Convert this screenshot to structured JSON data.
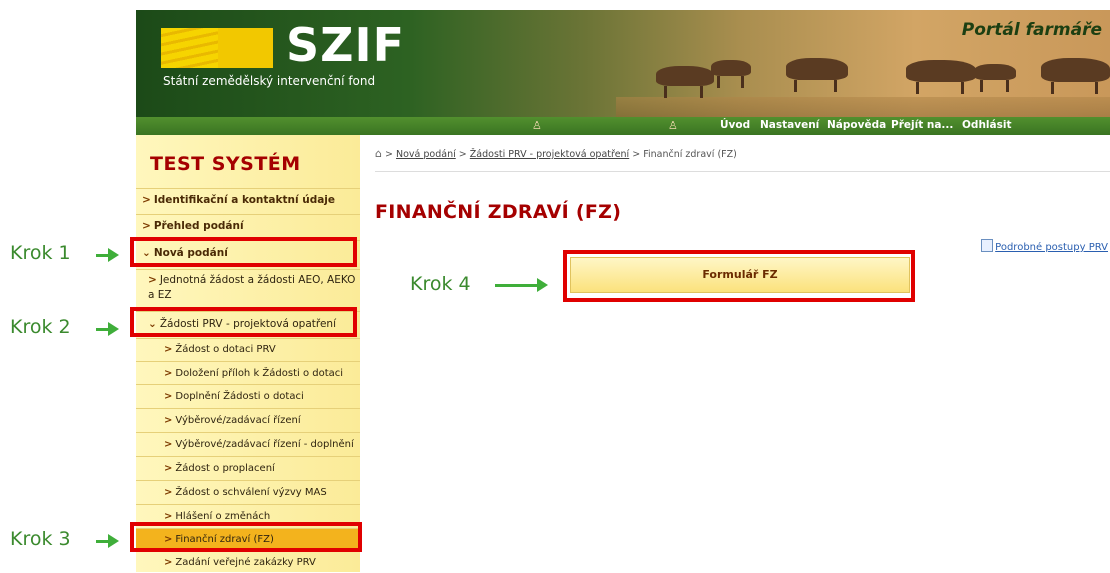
{
  "header": {
    "brand": "SZIF",
    "brand_subtitle": "Státní zemědělský intervenční fond",
    "portal_title": "Portál farmáře"
  },
  "topnav": {
    "items": [
      {
        "label": "Úvod"
      },
      {
        "label": "Nastavení"
      },
      {
        "label": "Nápověda"
      },
      {
        "label": "Přejít na..."
      },
      {
        "label": "Odhlásit"
      }
    ]
  },
  "sidebar": {
    "title": "TEST SYSTÉM",
    "items": [
      {
        "label": "Identifikační a kontaktní údaje"
      },
      {
        "label": "Přehled podání"
      },
      {
        "label": "Nová podání"
      },
      {
        "label": "Jednotná žádost a žádosti AEO, AEKO a EZ"
      },
      {
        "label": "Žádosti PRV - projektová opatření"
      },
      {
        "label": "Žádost o dotaci PRV"
      },
      {
        "label": "Doložení příloh k Žádosti o dotaci"
      },
      {
        "label": "Doplnění Žádosti o dotaci"
      },
      {
        "label": "Výběrové/zadávací řízení"
      },
      {
        "label": "Výběrové/zadávací řízení - doplnění"
      },
      {
        "label": "Žádost o proplacení"
      },
      {
        "label": "Žádost o schválení výzvy MAS"
      },
      {
        "label": "Hlášení o změnách"
      },
      {
        "label": "Finanční zdraví (FZ)"
      },
      {
        "label": "Zadání veřejné zakázky PRV"
      }
    ]
  },
  "breadcrumb": {
    "sep": ">",
    "items": [
      "Nová podání",
      "Žádosti PRV - projektová opatření",
      "Finanční zdraví (FZ)"
    ]
  },
  "main": {
    "title": "FINANČNÍ ZDRAVÍ (FZ)",
    "detail_link": "Podrobné postupy PRV",
    "form_button": "Formulář FZ"
  },
  "annotations": {
    "steps": [
      "Krok 1",
      "Krok 2",
      "Krok 3",
      "Krok 4"
    ],
    "arrow_color": "#3fae3a",
    "box_color": "#e00000"
  },
  "colors": {
    "header_green": "#2d6222",
    "nav_green": "#3a7422",
    "title_red": "#a50000",
    "sidebar_bg": "#fff7bd",
    "active_item": "#f3b31d"
  }
}
